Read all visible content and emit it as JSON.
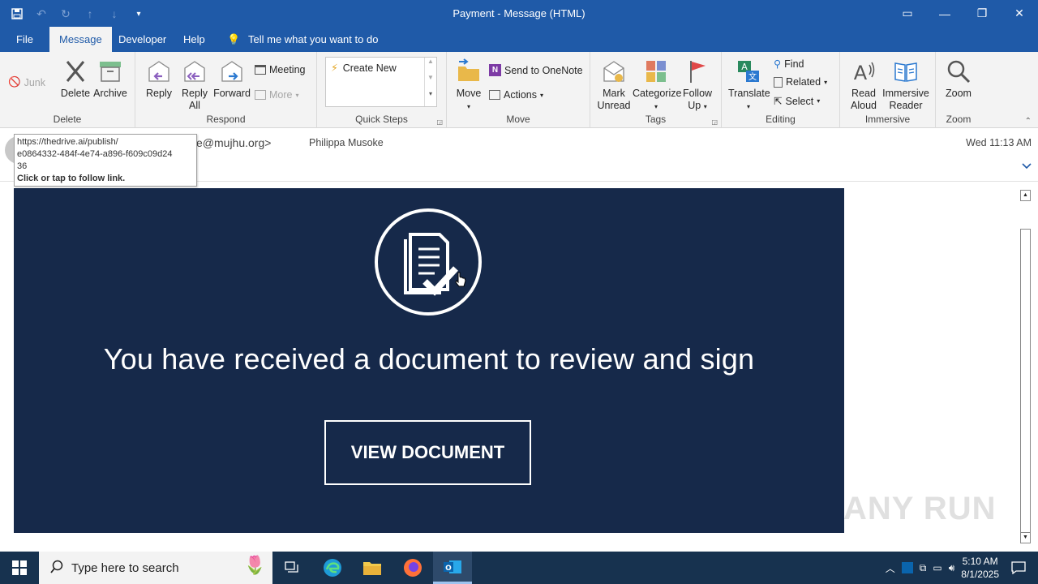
{
  "window": {
    "title": "Payment  -  Message (HTML)"
  },
  "tabs": [
    {
      "label": "File"
    },
    {
      "label": "Message"
    },
    {
      "label": "Developer"
    },
    {
      "label": "Help"
    }
  ],
  "tell_me": "Tell me what you want to do",
  "ribbon": {
    "delete_group": {
      "label": "Delete",
      "junk": "Junk",
      "delete": "Delete",
      "archive": "Archive"
    },
    "respond_group": {
      "label": "Respond",
      "reply": "Reply",
      "reply_all_1": "Reply",
      "reply_all_2": "All",
      "forward": "Forward",
      "meeting": "Meeting",
      "more": "More"
    },
    "quicksteps_group": {
      "label": "Quick Steps",
      "create_new": "Create New"
    },
    "move_group": {
      "label": "Move",
      "move": "Move",
      "onenote": "Send to OneNote",
      "actions": "Actions"
    },
    "tags_group": {
      "label": "Tags",
      "mark_unread_1": "Mark",
      "mark_unread_2": "Unread",
      "categorize": "Categorize",
      "follow_up_1": "Follow",
      "follow_up_2": "Up"
    },
    "editing_group": {
      "label": "Editing",
      "translate": "Translate",
      "find": "Find",
      "related": "Related",
      "select": "Select"
    },
    "immersive_group": {
      "label": "Immersive",
      "read_aloud_1": "Read",
      "read_aloud_2": "Aloud",
      "immersive_reader_1": "Immersive",
      "immersive_reader_2": "Reader"
    },
    "zoom_group": {
      "label": "Zoom",
      "zoom": "Zoom"
    }
  },
  "message_header": {
    "from_partial": "e@mujhu.org>",
    "to": "Philippa Musoke",
    "date": "Wed 11:13 AM"
  },
  "tooltip": {
    "line1": "https://thedrive.ai/publish/",
    "line2": "e0864332-484f-4e74-a896-f609c09d24",
    "line3": "36",
    "line4": "Click or tap to follow link."
  },
  "email": {
    "headline": "You have received a document to review and sign",
    "button": "VIEW DOCUMENT",
    "bg_color": "#16294a"
  },
  "watermark": "ANY RUN",
  "taskbar": {
    "search_placeholder": "Type here to search",
    "time": "5:10 AM",
    "date": "8/1/2025"
  },
  "colors": {
    "accent": "#1f5aa8",
    "taskbar": "#17324f"
  }
}
